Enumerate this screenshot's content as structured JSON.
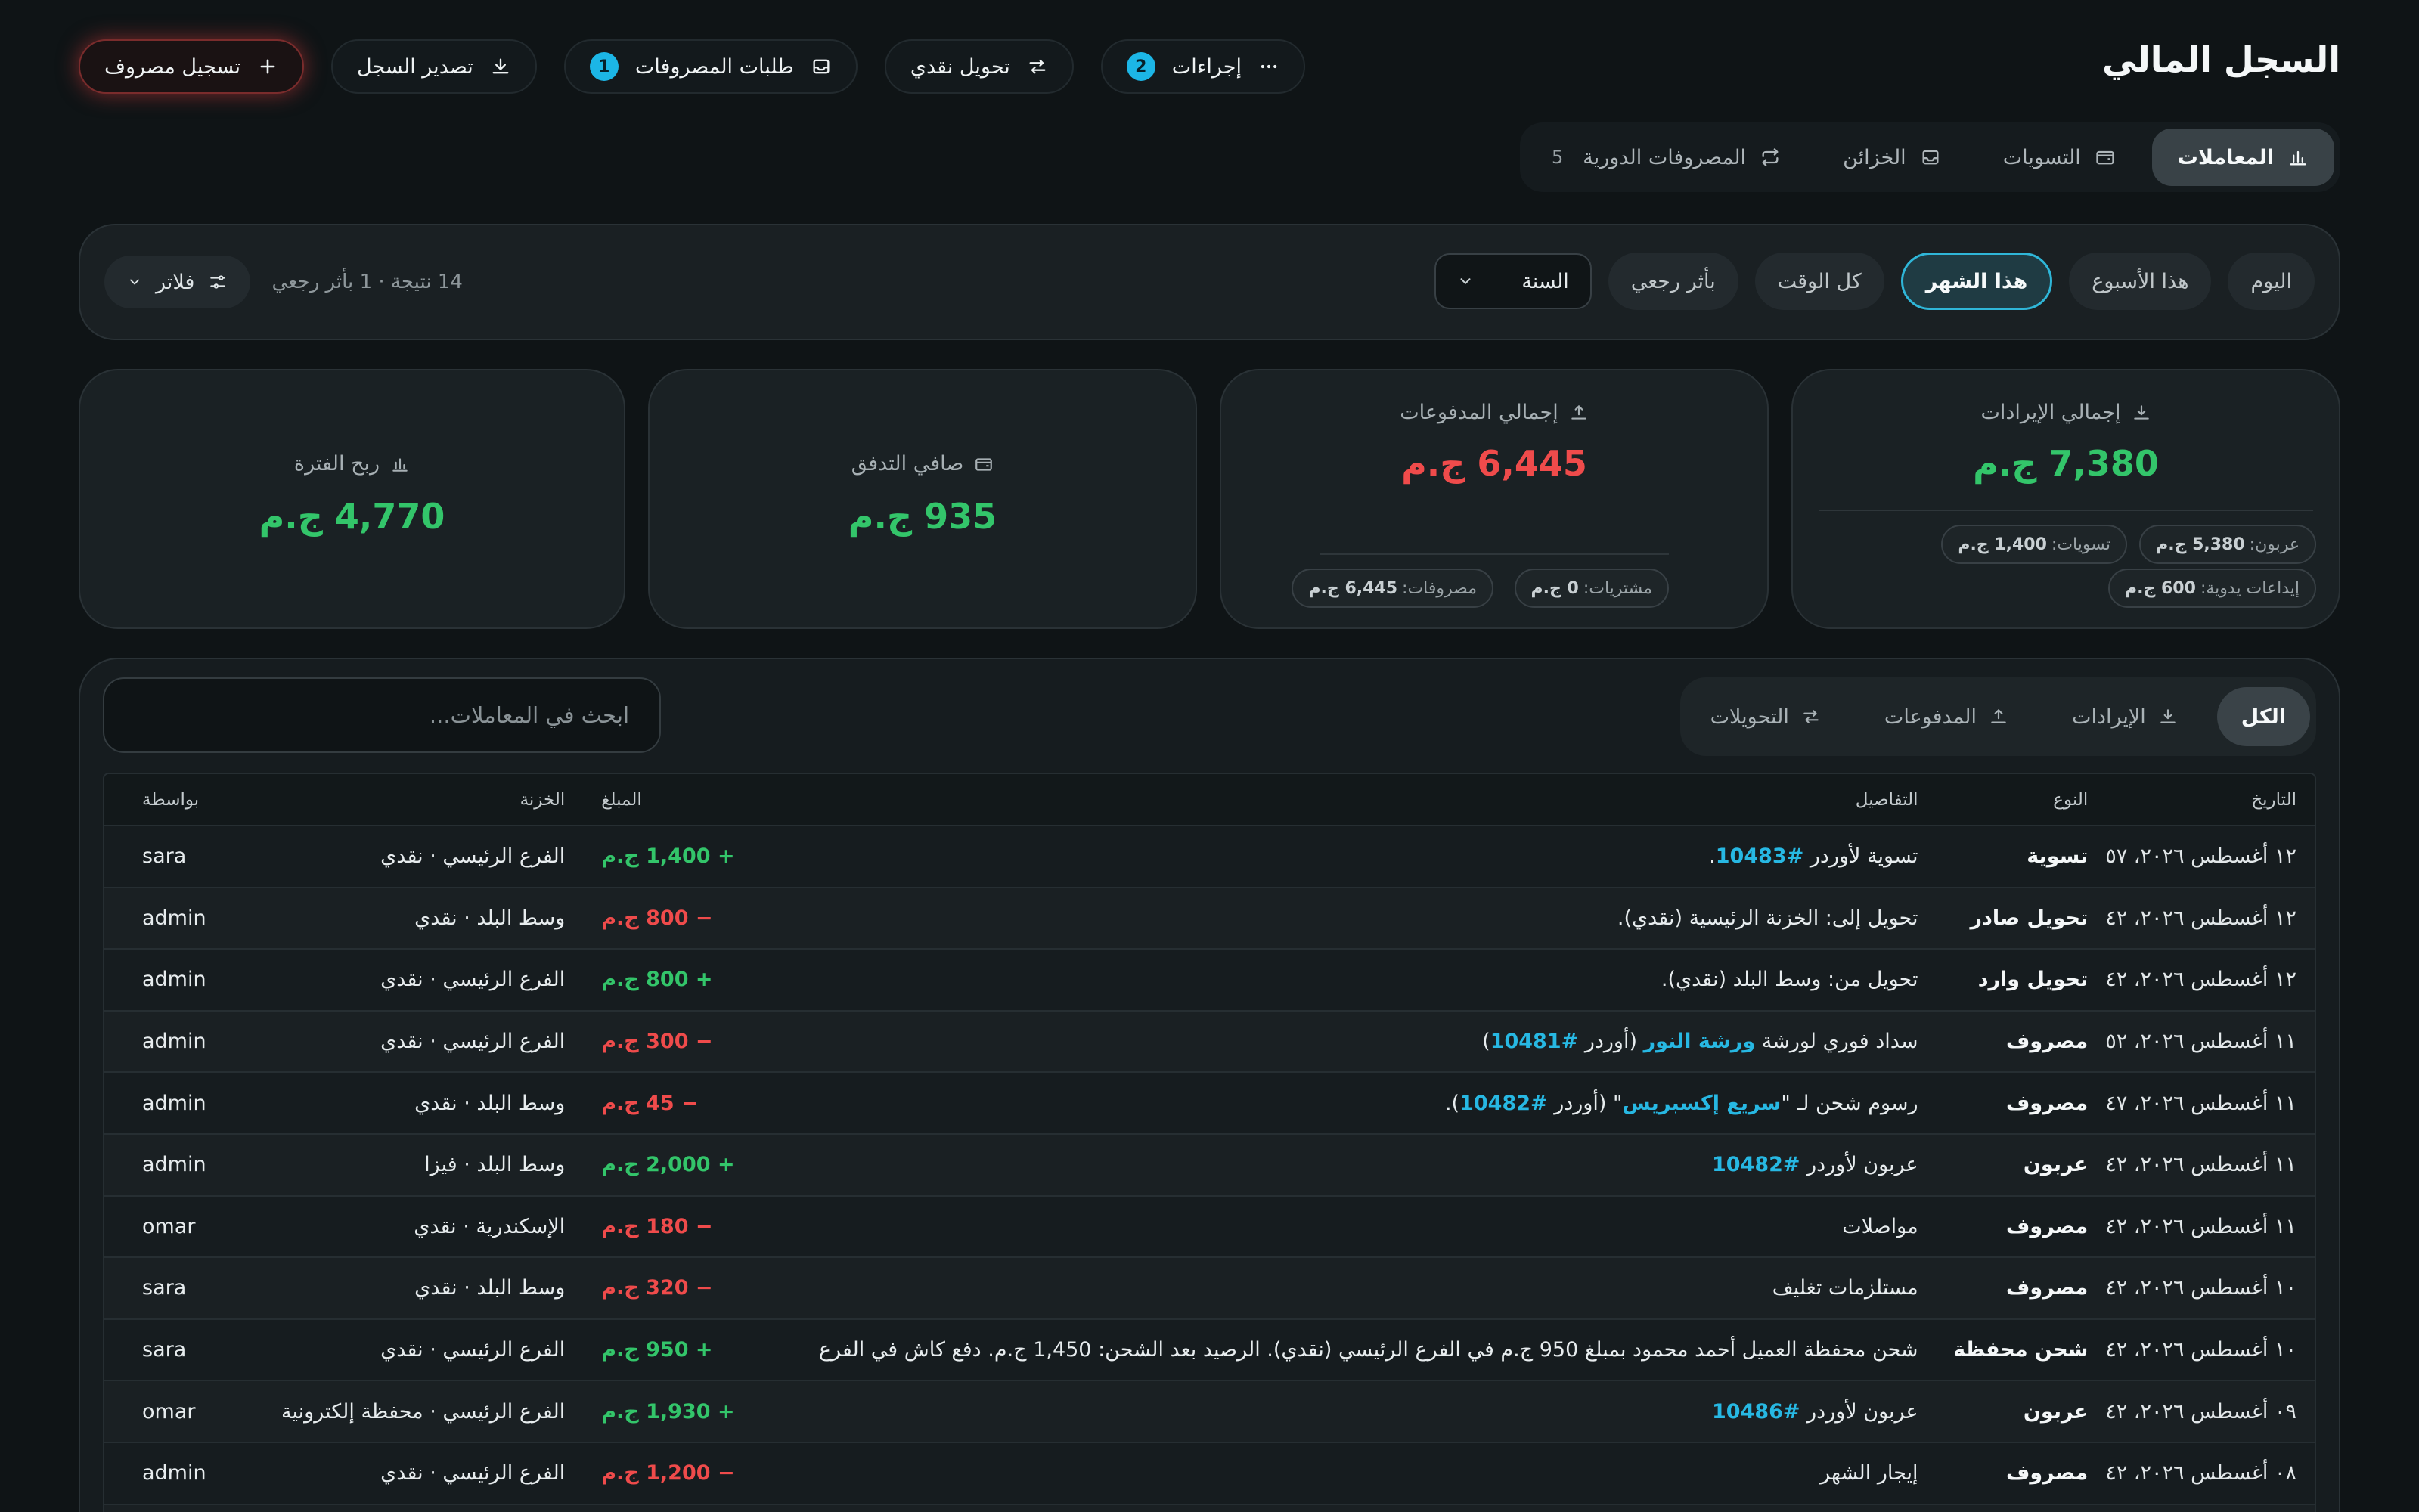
{
  "header": {
    "title": "السجل المالي",
    "actions": {
      "record_expense": "تسجيل مصروف",
      "export_ledger": "تصدير السجل",
      "expense_requests": "طلبات المصروفات",
      "expense_requests_badge": "1",
      "cash_transfer": "تحويل نقدي",
      "more_actions": "إجراءات",
      "more_actions_badge": "2"
    }
  },
  "tabs": {
    "transactions": "المعاملات",
    "settlements": "التسويات",
    "treasuries": "الخزائن",
    "recurring": "المصروفات الدورية",
    "recurring_count": "5"
  },
  "filters": {
    "periods": [
      "اليوم",
      "هذا الأسبوع",
      "هذا الشهر",
      "كل الوقت",
      "بأثر رجعي"
    ],
    "active_period": "هذا الشهر",
    "year_select": "السنة",
    "filter_button": "فلاتر",
    "results_text": "14 نتيجة · 1 بأثر رجعي"
  },
  "stats": {
    "income": {
      "title": "إجمالي الإيرادات",
      "value": "7,380 ج.م",
      "chips": [
        {
          "label": "عربون:",
          "value": "5,380 ج.م"
        },
        {
          "label": "تسويات:",
          "value": "1,400 ج.م"
        },
        {
          "label": "إيداعات يدوية:",
          "value": "600 ج.م"
        }
      ]
    },
    "payments": {
      "title": "إجمالي المدفوعات",
      "value": "6,445 ج.م",
      "chips": [
        {
          "label": "مشتريات:",
          "value": "0 ج.م"
        },
        {
          "label": "مصروفات:",
          "value": "6,445 ج.م"
        }
      ]
    },
    "net_flow": {
      "title": "صافي التدفق",
      "value": "935 ج.م"
    },
    "period_profit": {
      "title": "ربح الفترة",
      "value": "4,770 ج.م"
    }
  },
  "panel": {
    "type_tabs": {
      "all": "الكل",
      "income": "الإيرادات",
      "payments": "المدفوعات",
      "transfers": "التحويلات"
    },
    "search_placeholder": "ابحث في المعاملات...",
    "columns": {
      "date": "التاريخ",
      "type": "النوع",
      "details": "التفاصيل",
      "amount": "المبلغ",
      "treasury": "الخزنة",
      "by": "بواسطة"
    }
  },
  "rows": [
    {
      "date": "١٢ أغسطس ٢٠٢٦، ٠٩:٥٧ م",
      "type": "تسوية",
      "details_pre": "تسوية لأوردر ",
      "details_link": "#10483",
      "details_post": ".",
      "link2": "",
      "details_end": "",
      "amount": "+ 1,400 ج.م",
      "sign": "pos",
      "treasury": "الفرع الرئيسي · نقدي",
      "by": "sara"
    },
    {
      "date": "١٢ أغسطس ٢٠٢٦، ٠٩:٤٢ م",
      "type": "تحويل صادر",
      "details_pre": "تحويل إلى: الخزنة الرئيسية (نقدي).",
      "details_link": "",
      "details_post": "",
      "link2": "",
      "details_end": "",
      "amount": "− 800 ج.م",
      "sign": "neg",
      "treasury": "وسط البلد · نقدي",
      "by": "admin"
    },
    {
      "date": "١٢ أغسطس ٢٠٢٦، ٠٩:٤٢ م",
      "type": "تحويل وارد",
      "details_pre": "تحويل من: وسط البلد (نقدي).",
      "details_link": "",
      "details_post": "",
      "link2": "",
      "details_end": "",
      "amount": "+ 800 ج.م",
      "sign": "pos",
      "treasury": "الفرع الرئيسي · نقدي",
      "by": "admin"
    },
    {
      "date": "١١ أغسطس ٢٠٢٦، ٠٩:٥٢ م",
      "type": "مصروف",
      "details_pre": "سداد فوري لورشة ",
      "details_link": "ورشة النور",
      "details_post": " (أوردر ",
      "link2": "#10481",
      "details_end": ")",
      "amount": "− 300 ج.م",
      "sign": "neg",
      "treasury": "الفرع الرئيسي · نقدي",
      "by": "admin"
    },
    {
      "date": "١١ أغسطس ٢٠٢٦، ٠٩:٤٧ م",
      "type": "مصروف",
      "details_pre": "رسوم شحن لـ \"",
      "details_link": "سريع إكسبريس",
      "details_post": "\" (أوردر ",
      "link2": "#10482",
      "details_end": ").",
      "amount": "− 45 ج.م",
      "sign": "neg",
      "treasury": "وسط البلد · نقدي",
      "by": "admin"
    },
    {
      "date": "١١ أغسطس ٢٠٢٦، ٠٩:٤٢ م",
      "type": "عربون",
      "details_pre": "عربون لأوردر ",
      "details_link": "#10482",
      "details_post": "",
      "link2": "",
      "details_end": "",
      "amount": "+ 2,000 ج.م",
      "sign": "pos",
      "treasury": "وسط البلد · فيزا",
      "by": "admin"
    },
    {
      "date": "١١ أغسطس ٢٠٢٦، ٠٩:٤٢ م",
      "type": "مصروف",
      "details_pre": "مواصلات",
      "details_link": "",
      "details_post": "",
      "link2": "",
      "details_end": "",
      "amount": "− 180 ج.م",
      "sign": "neg",
      "treasury": "الإسكندرية · نقدي",
      "by": "omar"
    },
    {
      "date": "١٠ أغسطس ٢٠٢٦، ٠٩:٤٢ م",
      "type": "مصروف",
      "details_pre": "مستلزمات تغليف",
      "details_link": "",
      "details_post": "",
      "link2": "",
      "details_end": "",
      "amount": "− 320 ج.م",
      "sign": "neg",
      "treasury": "وسط البلد · نقدي",
      "by": "sara"
    },
    {
      "date": "١٠ أغسطس ٢٠٢٦، ٠٩:٤٢ م",
      "type": "شحن محفظة",
      "details_pre": "شحن محفظة العميل أحمد محمود بمبلغ 950 ج.م في الفرع الرئيسي (نقدي). الرصيد بعد الشحن: 1,450 ج.م. دفع كاش في الفرع",
      "details_link": "",
      "details_post": "",
      "link2": "",
      "details_end": "",
      "amount": "+ 950 ج.م",
      "sign": "pos",
      "treasury": "الفرع الرئيسي · نقدي",
      "by": "sara"
    },
    {
      "date": "٠٩ أغسطس ٢٠٢٦، ٠٩:٤٢ م",
      "type": "عربون",
      "details_pre": "عربون لأوردر ",
      "details_link": "#10486",
      "details_post": "",
      "link2": "",
      "details_end": "",
      "amount": "+ 1,930 ج.م",
      "sign": "pos",
      "treasury": "الفرع الرئيسي · محفظة إلكترونية",
      "by": "omar"
    },
    {
      "date": "٠٨ أغسطس ٢٠٢٦، ٠٩:٤٢ م",
      "type": "مصروف",
      "details_pre": "إيجار الشهر",
      "details_link": "",
      "details_post": "",
      "link2": "",
      "details_end": "",
      "amount": "− 1,200 ج.م",
      "sign": "neg",
      "treasury": "الفرع الرئيسي · نقدي",
      "by": "admin"
    },
    {
      "date": "",
      "type": "",
      "details_pre": "",
      "details_link": "",
      "details_post": "",
      "link2": "",
      "details_end": "",
      "amount": "",
      "sign": "neg",
      "treasury": "",
      "by": ""
    }
  ],
  "colors": {
    "positive": "#33c56a",
    "negative": "#ef4b4b",
    "accent": "#1cb6e6",
    "background": "#0f1416"
  }
}
